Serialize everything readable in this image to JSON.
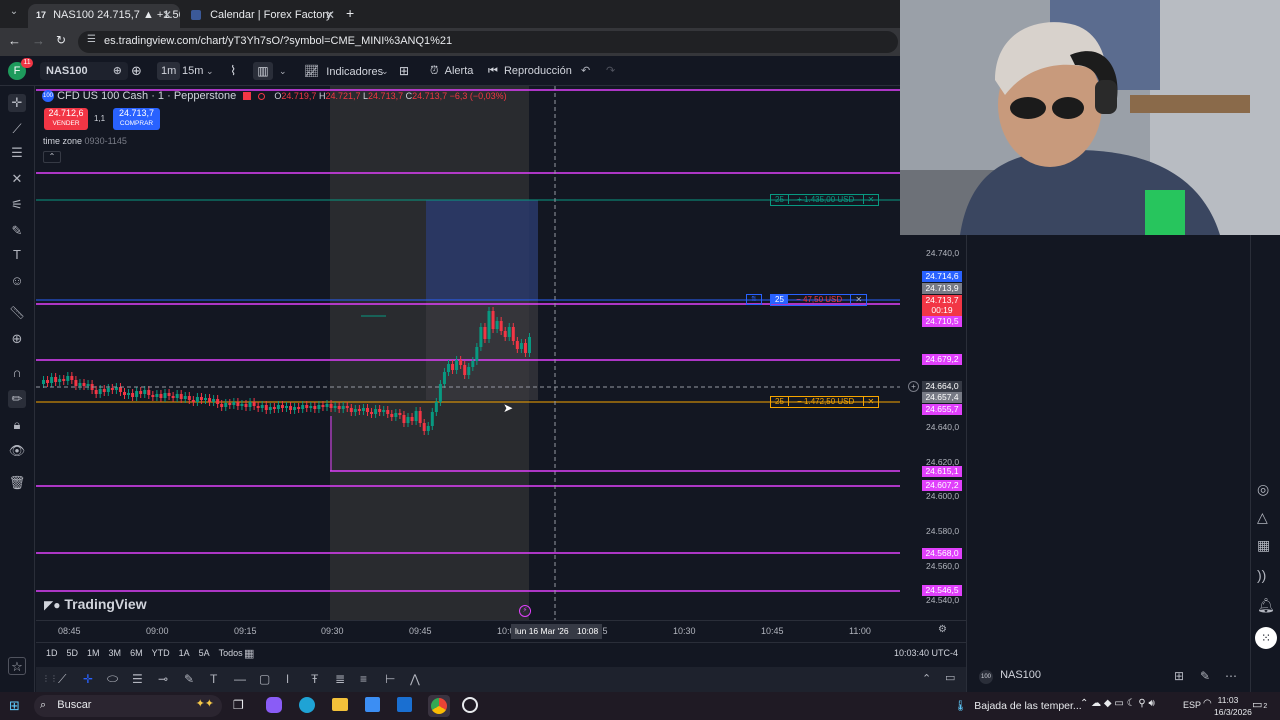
{
  "browser": {
    "tabs": [
      {
        "title": "NAS100 24.715,7 ▲ +1.56% fa",
        "active": true
      },
      {
        "title": "Calendar | Forex Factory",
        "active": false
      }
    ],
    "url": "es.tradingview.com/chart/yT3Yh7sO/?symbol=CME_MINI%3ANQ1%21"
  },
  "toolbar": {
    "profile_initial": "F",
    "notification_count": "11",
    "symbol": "NAS100",
    "interval_1": "1m",
    "interval_2": "15m",
    "indicators": "Indicadores",
    "alert": "Alerta",
    "replay": "Reproducción"
  },
  "legend": {
    "instrument": "CFD US 100 Cash · 1 · Pepperstone",
    "o_label": "O",
    "o": "24.719,7",
    "h_label": "H",
    "h": "24.721,7",
    "l_label": "L",
    "l": "24.713,7",
    "c_label": "C",
    "c": "24.713,7 −6,3 (−0,03%)",
    "sell_price": "24.712,6",
    "sell_label": "VENDER",
    "spread": "1,1",
    "buy_price": "24.713,7",
    "buy_label": "COMPRAR",
    "indicator_name": "time zone",
    "indicator_value": "0930-1145"
  },
  "positions": {
    "tp": {
      "qty": "25",
      "pnl": "+ 1.435,00 USD"
    },
    "entry": {
      "qty": "25",
      "pnl": "− 47,50 USD"
    },
    "sl": {
      "qty": "25",
      "pnl": "− 1.472,50 USD"
    }
  },
  "price_axis": {
    "ticks": [
      "24.740,0",
      "24.640,0",
      "24.620,0",
      "24.600,0",
      "24.580,0",
      "24.560,0",
      "24.540,0"
    ],
    "labels": [
      {
        "text": "24.714,6",
        "color": "#2962ff"
      },
      {
        "text": "24.713,9",
        "color": "#787b86"
      },
      {
        "text": "24.713,7",
        "color": "#f23645"
      },
      {
        "text": "00:19",
        "color": "#f23645"
      },
      {
        "text": "24.710,5",
        "color": "#e040fb"
      },
      {
        "text": "24.679,2",
        "color": "#e040fb"
      },
      {
        "text": "24.664,0",
        "color": "#363a45"
      },
      {
        "text": "24.657,4",
        "color": "#787b86"
      },
      {
        "text": "24.655,7",
        "color": "#e040fb"
      },
      {
        "text": "24.615,1",
        "color": "#e040fb"
      },
      {
        "text": "24.607,2",
        "color": "#e040fb"
      },
      {
        "text": "24.568,0",
        "color": "#e040fb"
      },
      {
        "text": "24.546,5",
        "color": "#e040fb"
      }
    ]
  },
  "time_axis": {
    "ticks": [
      "08:45",
      "09:00",
      "09:15",
      "09:30",
      "09:45",
      "10:00",
      "10:15",
      "10:30",
      "10:45",
      "11:00"
    ],
    "crosshair_date": "lun 16 Mar '26",
    "crosshair_time": "10:08"
  },
  "watermark": "TradingView",
  "range_buttons": [
    "1D",
    "5D",
    "1M",
    "3M",
    "6M",
    "YTD",
    "1A",
    "5A",
    "Todos"
  ],
  "clock": "10:03:40 UTC-4",
  "watchlist": {
    "symbol": "NAS100"
  },
  "taskbar": {
    "search": "Buscar",
    "weather": "Bajada de las temper...",
    "lang": "ESP",
    "time": "11:03",
    "date": "16/3/2026",
    "notif": "2"
  }
}
